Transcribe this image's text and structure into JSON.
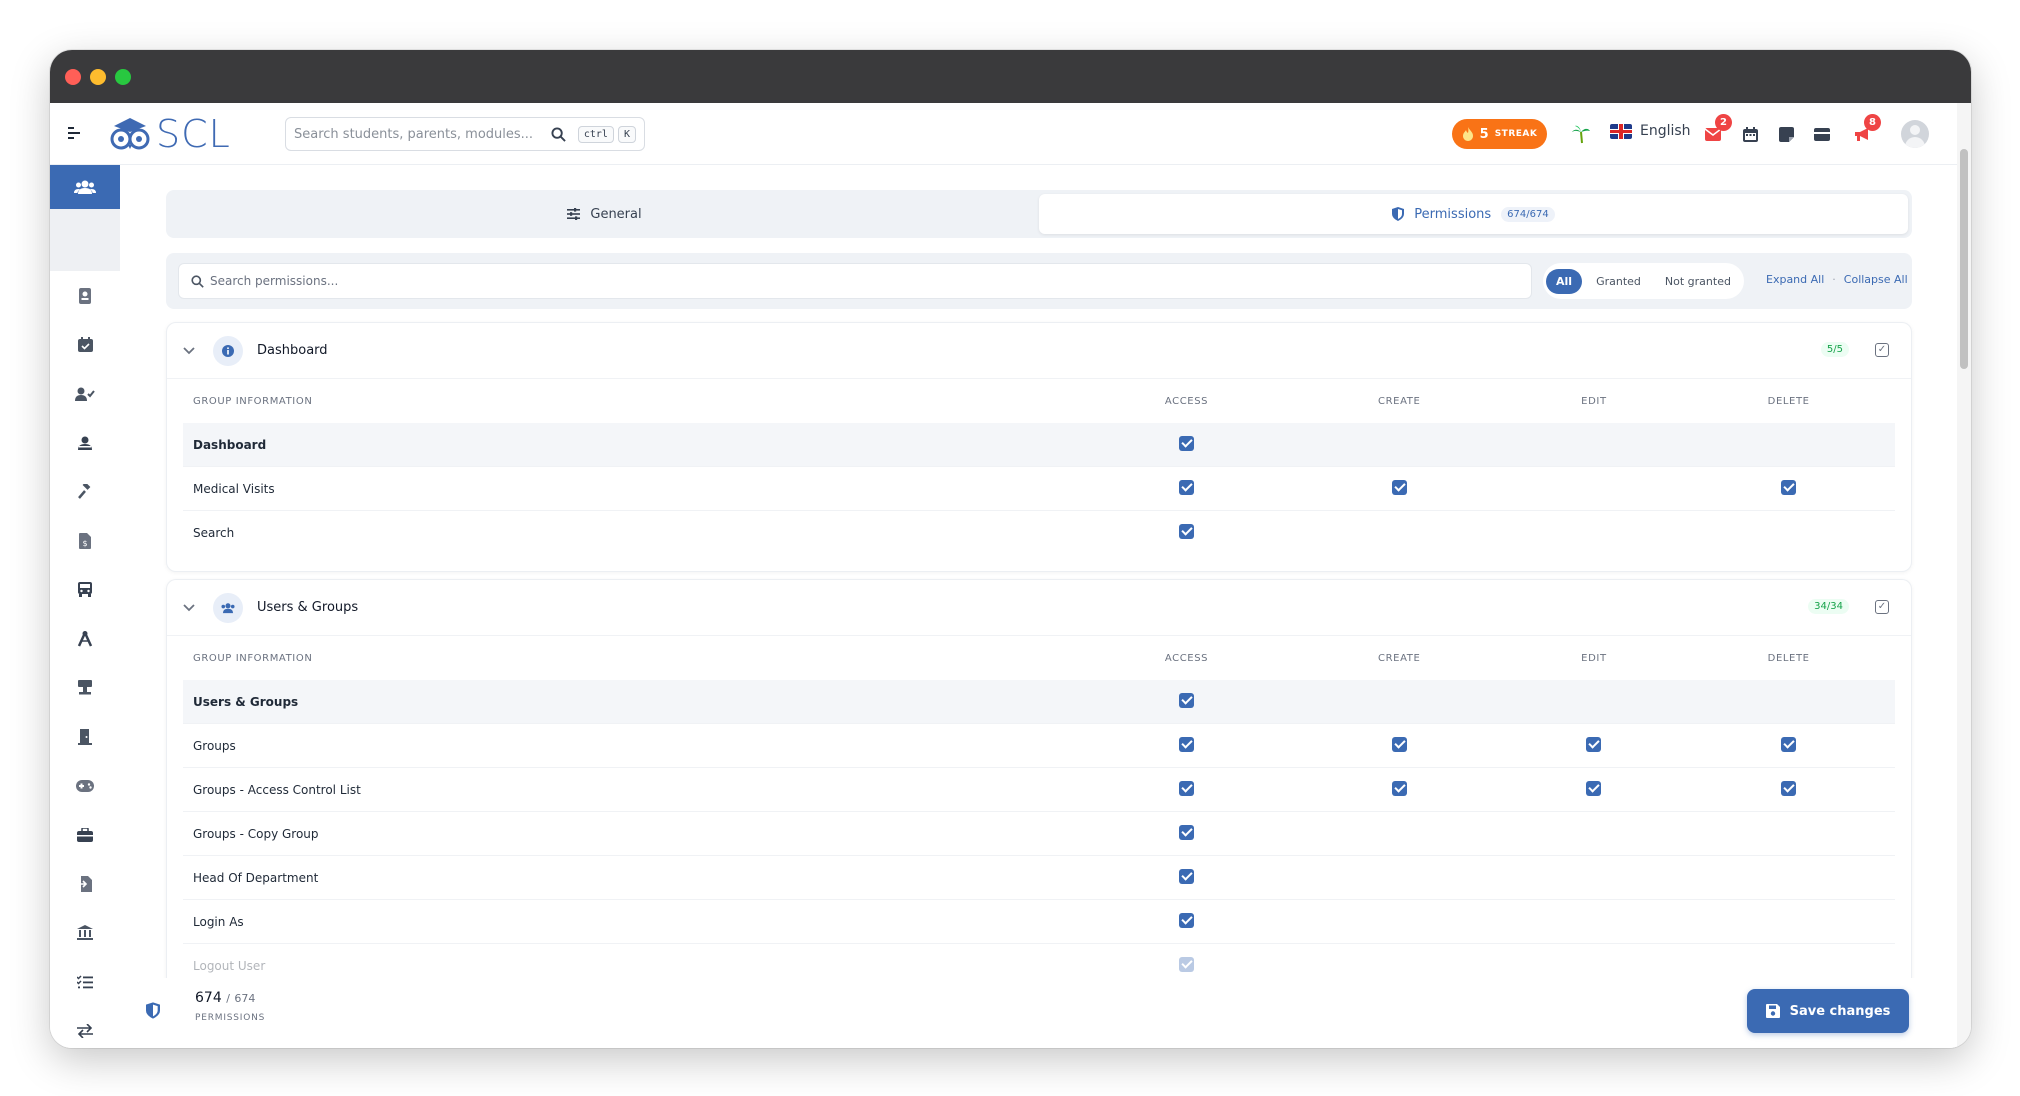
{
  "header": {
    "logo_text": "SCL",
    "search_placeholder": "Search students, parents, modules...",
    "shortcut_ctrl": "ctrl",
    "shortcut_k": "K",
    "streak_count": "5",
    "streak_label": "STREAK",
    "language": "English",
    "mail_badge": "2",
    "notif_badge": "8"
  },
  "tabs": {
    "general": "General",
    "permissions": "Permissions",
    "permissions_count": "674/674"
  },
  "filters": {
    "search_placeholder": "Search permissions...",
    "all": "All",
    "granted": "Granted",
    "not_granted": "Not granted",
    "expand_all": "Expand All",
    "collapse_all": "Collapse All"
  },
  "columns": {
    "group_info": "GROUP INFORMATION",
    "access": "ACCESS",
    "create": "CREATE",
    "edit": "EDIT",
    "delete": "DELETE"
  },
  "groups": [
    {
      "title": "Dashboard",
      "count": "5/5",
      "rows": [
        {
          "name": "Dashboard",
          "access": true,
          "create": false,
          "edit": false,
          "delete": false
        },
        {
          "name": "Medical Visits",
          "access": true,
          "create": true,
          "edit": false,
          "delete": true
        },
        {
          "name": "Search",
          "access": true,
          "create": false,
          "edit": false,
          "delete": false
        }
      ]
    },
    {
      "title": "Users & Groups",
      "count": "34/34",
      "rows": [
        {
          "name": "Users & Groups",
          "access": true,
          "create": false,
          "edit": false,
          "delete": false
        },
        {
          "name": "Groups",
          "access": true,
          "create": true,
          "edit": true,
          "delete": true
        },
        {
          "name": "Groups - Access Control List",
          "access": true,
          "create": true,
          "edit": true,
          "delete": true
        },
        {
          "name": "Groups - Copy Group",
          "access": true,
          "create": false,
          "edit": false,
          "delete": false
        },
        {
          "name": "Head Of Department",
          "access": true,
          "create": false,
          "edit": false,
          "delete": false
        },
        {
          "name": "Login As",
          "access": true,
          "create": false,
          "edit": false,
          "delete": false
        },
        {
          "name": "Logout User",
          "access": true,
          "create": false,
          "edit": false,
          "delete": false
        }
      ]
    }
  ],
  "footer": {
    "granted": "674",
    "slash": "/",
    "total": "674",
    "label": "PERMISSIONS",
    "save_label": "Save changes"
  },
  "colors": {
    "accent": "#3b6ab3",
    "streak": "#f97316",
    "badge": "#ef4444"
  }
}
